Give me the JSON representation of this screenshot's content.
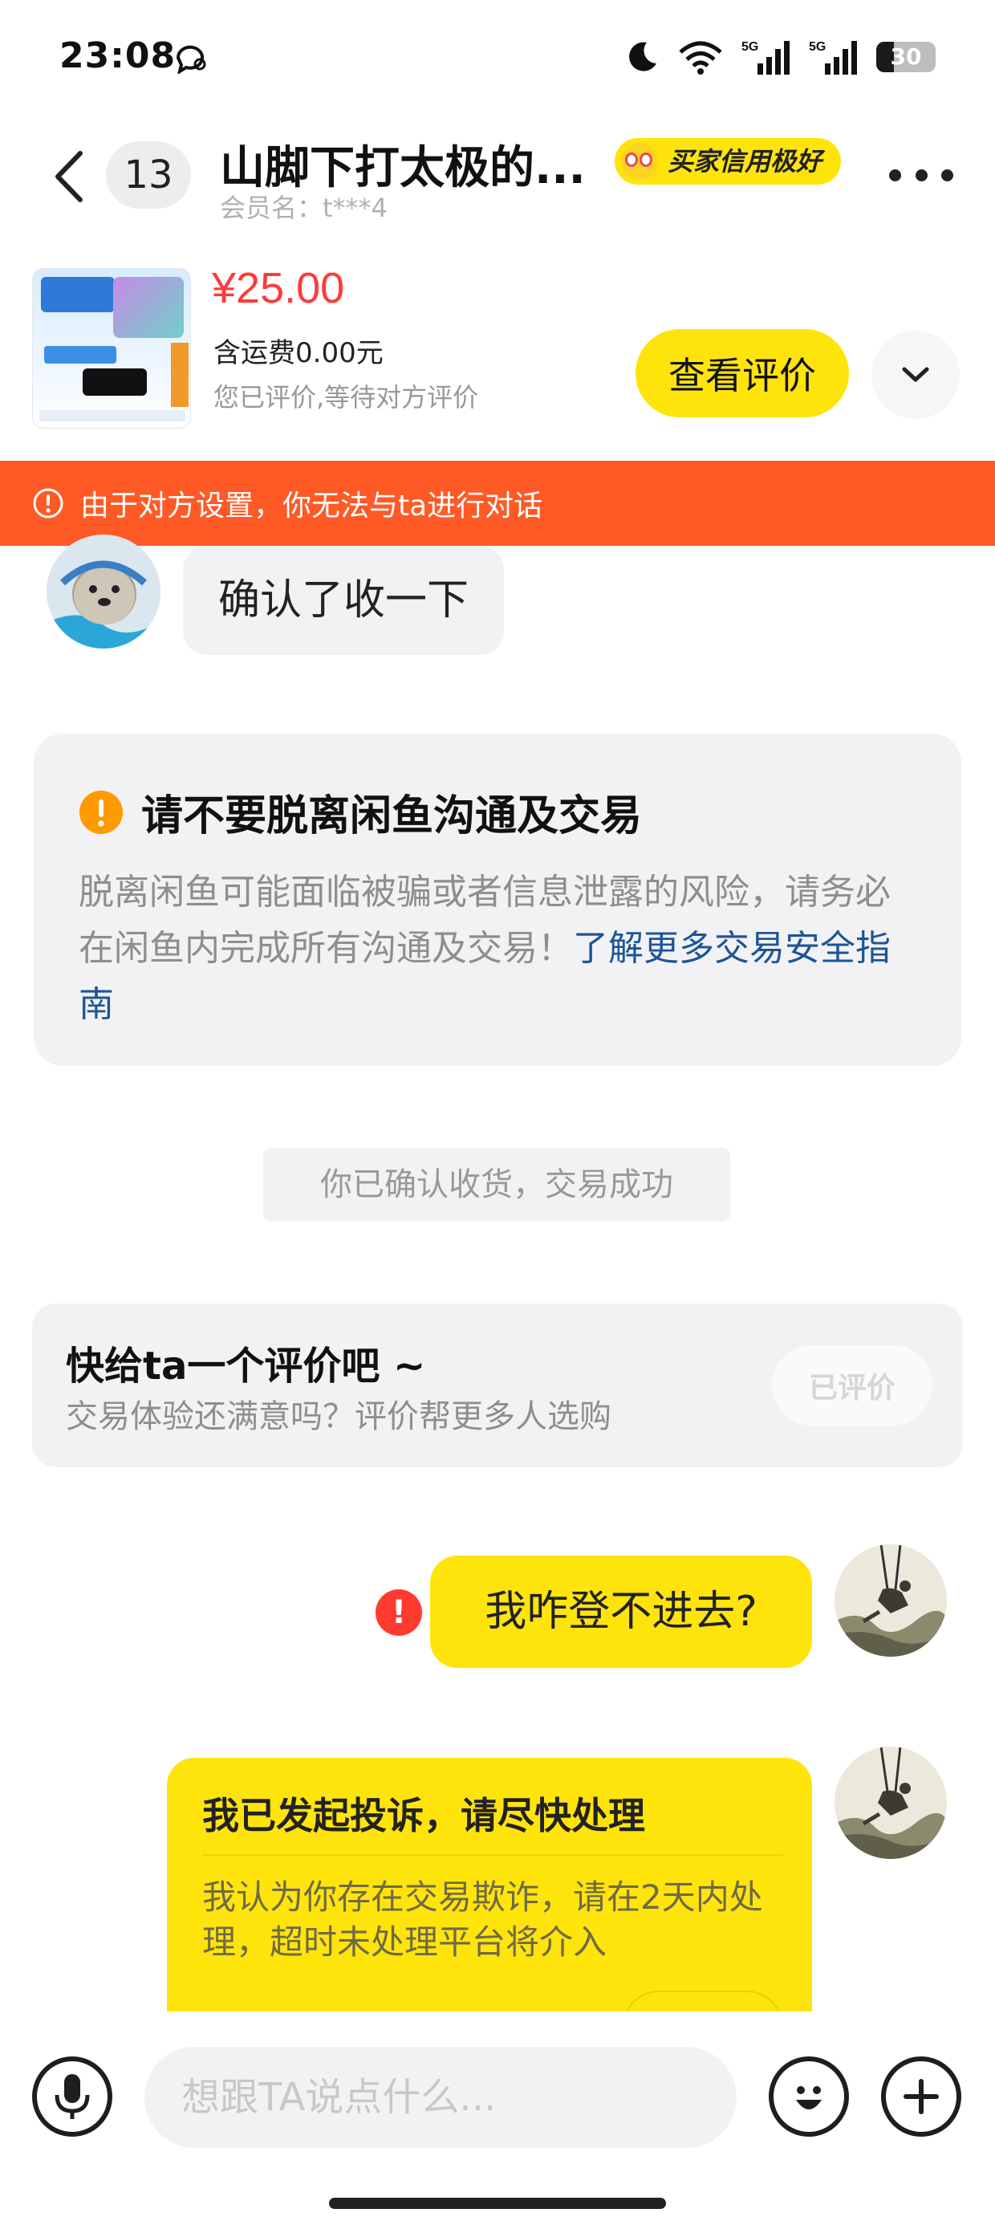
{
  "status_bar": {
    "time": "23:08",
    "network_1": "5G",
    "network_2": "5G",
    "battery_level": "30"
  },
  "header": {
    "unread_count": "13",
    "contact_name": "山脚下打太极的...",
    "member_label": "会员名：t***4",
    "credit_badge": "买家信用极好"
  },
  "product": {
    "price": "¥25.00",
    "shipping": "含运费0.00元",
    "review_status": "您已评价,等待对方评价",
    "view_review_label": "查看评价"
  },
  "banner": {
    "text": "由于对方设置，你无法与ta进行对话",
    "color": "#ff5a26"
  },
  "messages": {
    "incoming_text": "确认了收一下",
    "safety": {
      "title": "请不要脱离闲鱼沟通及交易",
      "body": "脱离闲鱼可能面临被骗或者信息泄露的风险，请务必在闲鱼内完成所有沟通及交易！",
      "link": "了解更多交易安全指南"
    },
    "system_note": "你已确认收货，交易成功",
    "rate": {
      "title": "快给ta一个评价吧 ~",
      "subtitle": "交易体验还满意吗？评价帮更多人选购",
      "button": "已评价"
    },
    "outgoing_text": "我咋登不进去?",
    "outgoing_failed_mark": "!",
    "complaint": {
      "title": "我已发起投诉，请尽快处理",
      "body": "我认为你存在交易欺诈，请在2天内处理，超时未处理平台将介入"
    }
  },
  "input_bar": {
    "placeholder": "想跟TA说点什么..."
  },
  "colors": {
    "brand_yellow": "#ffe40c",
    "price_red": "#ff3a3a",
    "link_blue": "#1d5596",
    "error_red": "#ff3b30"
  },
  "icons": [
    "wechat-bubble-icon",
    "moon-icon",
    "wifi-icon",
    "signal-icon",
    "battery-icon",
    "back-arrow-icon",
    "more-dots-icon",
    "chevron-down-icon",
    "alert-circle-icon",
    "warning-icon",
    "error-icon",
    "microphone-icon",
    "emoji-icon",
    "plus-icon"
  ]
}
